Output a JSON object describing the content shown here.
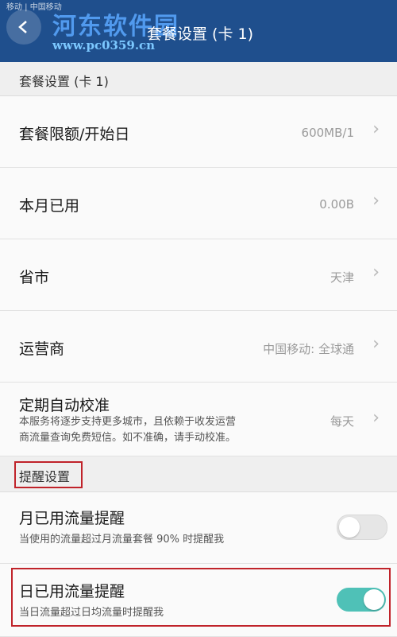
{
  "app": {
    "title": "套餐设置 (卡 1)",
    "status_text": "移动 | 中国移动"
  },
  "watermark": {
    "name": "河东软件园",
    "url": "www.pc0359.cn"
  },
  "section_plan": {
    "header": "套餐设置 (卡 1)"
  },
  "rows": [
    {
      "label": "套餐限额/开始日",
      "value": "600MB/1"
    },
    {
      "label": "本月已用",
      "value": "0.00B"
    },
    {
      "label": "省市",
      "value": "天津"
    },
    {
      "label": "运营商",
      "value": "中国移动: 全球通"
    },
    {
      "label": "定期自动校准",
      "value": "每天",
      "sub1": "本服务将逐步支持更多城市，且依赖于收发运营",
      "sub2": "商流量查询免费短信。如不准确，请手动校准。"
    }
  ],
  "section_reminder": {
    "header": "提醒设置"
  },
  "toggles": [
    {
      "label": "月已用流量提醒",
      "sub": "当使用的流量超过月流量套餐 90% 时提醒我",
      "on": false
    },
    {
      "label": "日已用流量提醒",
      "sub": "当日流量超过日均流量时提醒我",
      "on": true
    }
  ],
  "colors": {
    "topbar": "#1f4f8d",
    "toggle_on": "#4fc1b7",
    "highlight": "#c0232a"
  },
  "icons": {
    "back": "back-arrow-icon",
    "chevron": "chevron-right-icon"
  }
}
